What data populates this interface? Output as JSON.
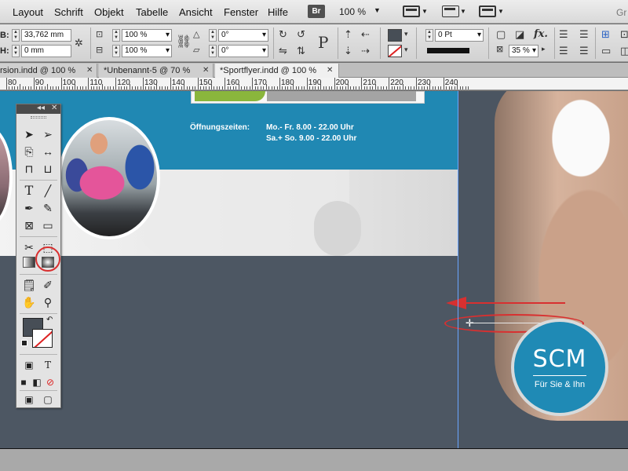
{
  "menubar": {
    "items": [
      "Layout",
      "Schrift",
      "Objekt",
      "Tabelle",
      "Ansicht",
      "Fenster",
      "Hilfe"
    ],
    "bridge_label": "Br",
    "zoom": "100 %",
    "workspace_partial": "Gr"
  },
  "controlbar": {
    "width_label": "B:",
    "width_value": "33,762 mm",
    "height_label": "H:",
    "height_value": "0 mm",
    "scale_x": "100 %",
    "scale_y": "100 %",
    "rotation": "0°",
    "shear": "0°",
    "stroke_weight": "0 Pt",
    "opacity": "35 %",
    "text_frame_glyph": "P",
    "fx_label": "fx."
  },
  "tabs": [
    {
      "label": "rsion.indd @ 100 %",
      "active": false
    },
    {
      "label": "*Unbenannt-5 @ 70 %",
      "active": false
    },
    {
      "label": "*Sportflyer.indd @ 100 %",
      "active": true
    }
  ],
  "ruler": {
    "labels": [
      "80",
      "90",
      "100",
      "110",
      "120",
      "130",
      "140",
      "150",
      "160",
      "170",
      "180",
      "190",
      "200",
      "210",
      "220",
      "230",
      "240"
    ]
  },
  "document": {
    "hours_label": "Öffnungszeiten:",
    "hours_lines": [
      "Mo.- Fr. 8.00 - 22.00 Uhr",
      "Sa.+ So. 9.00 - 22.00 Uhr"
    ],
    "logo_text": "SCM",
    "logo_subtitle": "Für Sie & Ihn"
  },
  "toolpanel": {
    "collapse": "◂◂",
    "close": "✕"
  },
  "colors": {
    "accent_teal": "#2088b3",
    "panel_dark": "#4b5561",
    "annotation_red": "#d83030",
    "guide_blue": "#6aa6ff"
  }
}
